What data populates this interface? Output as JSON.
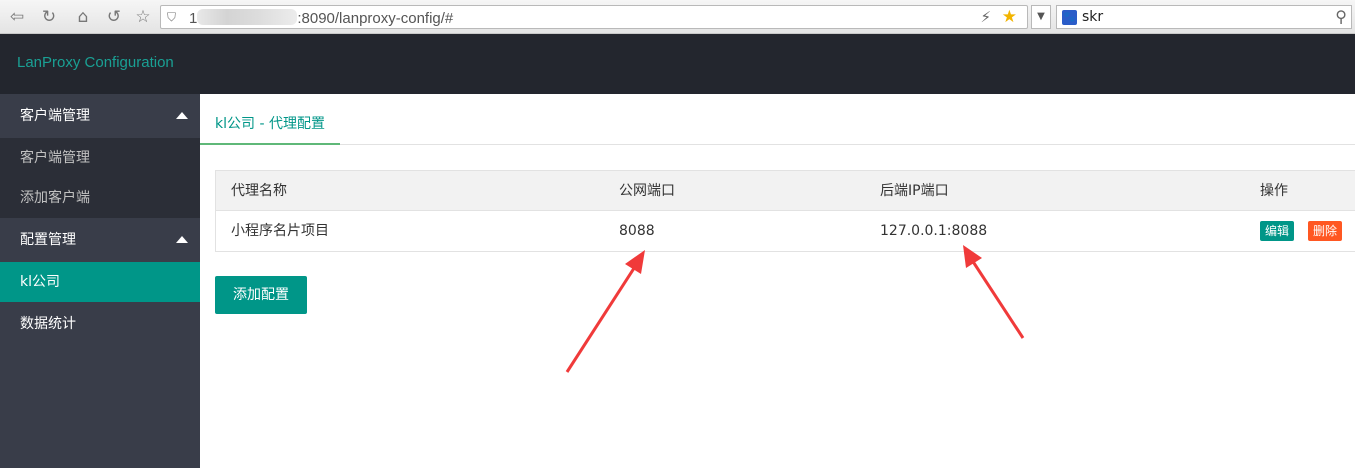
{
  "browser": {
    "back_icon": "back-arrow-icon",
    "forward_icon": "forward-arrow-icon",
    "url_prefix": "1",
    "url_suffix": ":8090/lanproxy-config/#",
    "search_text": "skr"
  },
  "header": {
    "title": "LanProxy Configuration"
  },
  "sidebar": {
    "groups": [
      {
        "label": "客户端管理",
        "items": [
          "客户端管理",
          "添加客户端"
        ]
      },
      {
        "label": "配置管理",
        "items": [
          "kl公司"
        ]
      }
    ],
    "stats_label": "数据统计",
    "active_item": "kl公司"
  },
  "main": {
    "tab_label": "kl公司 - 代理配置",
    "table": {
      "headers": [
        "代理名称",
        "公网端口",
        "后端IP端口",
        "操作"
      ],
      "rows": [
        {
          "name": "小程序名片项目",
          "public_port": "8088",
          "backend": "127.0.0.1:8088"
        }
      ],
      "edit_label": "编辑",
      "delete_label": "删除"
    },
    "add_button": "添加配置"
  },
  "colors": {
    "accent": "#009688",
    "danger": "#ff5722",
    "header_bg": "#23262e",
    "sidebar_bg": "#393d49",
    "annotation": "#f03a3a"
  }
}
